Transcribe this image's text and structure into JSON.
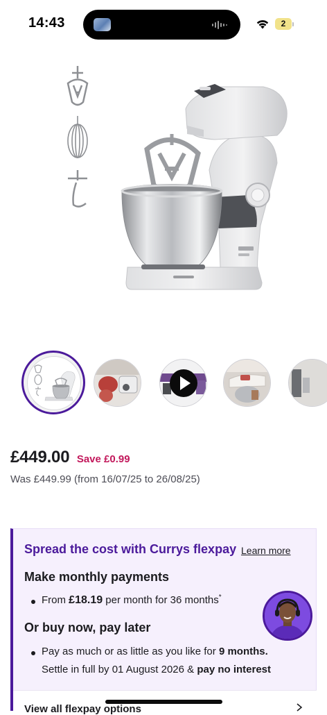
{
  "status_bar": {
    "time": "14:43",
    "battery_level": "2",
    "icons": [
      "wifi-icon",
      "battery-icon"
    ]
  },
  "product": {
    "hero_image": "kenwood-stand-mixer-image",
    "thumbnails": [
      {
        "name": "mixer-thumbnail",
        "selected": true
      },
      {
        "name": "dough-thumbnail",
        "selected": false
      },
      {
        "name": "video-thumbnail",
        "selected": false,
        "icon": "play-icon"
      },
      {
        "name": "mixer-in-use-thumbnail",
        "selected": false
      },
      {
        "name": "kitchen-thumbnail",
        "selected": false
      }
    ]
  },
  "pricing": {
    "price": "£449.00",
    "save": "Save £0.99",
    "was": "Was £449.99 (from 16/07/25 to 26/08/25)"
  },
  "flexpay": {
    "title": "Spread the cost with Currys flexpay",
    "learn_more": "Learn more",
    "monthly_heading": "Make monthly payments",
    "monthly_from": "From",
    "monthly_amount": "£18.19",
    "monthly_suffix": "per month for 36 months",
    "monthly_marker": "*",
    "bnpl_heading": "Or buy now, pay later",
    "bnpl_line1_prefix": "Pay as much or as little as you like for",
    "bnpl_line1_bold": "9 months.",
    "bnpl_line2_prefix": "Settle in full by 01 August 2026 &",
    "bnpl_line2_bold": "pay no interest",
    "view_all": "View all flexpay options",
    "colors": {
      "accent": "#4b1a9b",
      "save": "#c2185b",
      "card_bg": "#f6f0fd"
    }
  }
}
